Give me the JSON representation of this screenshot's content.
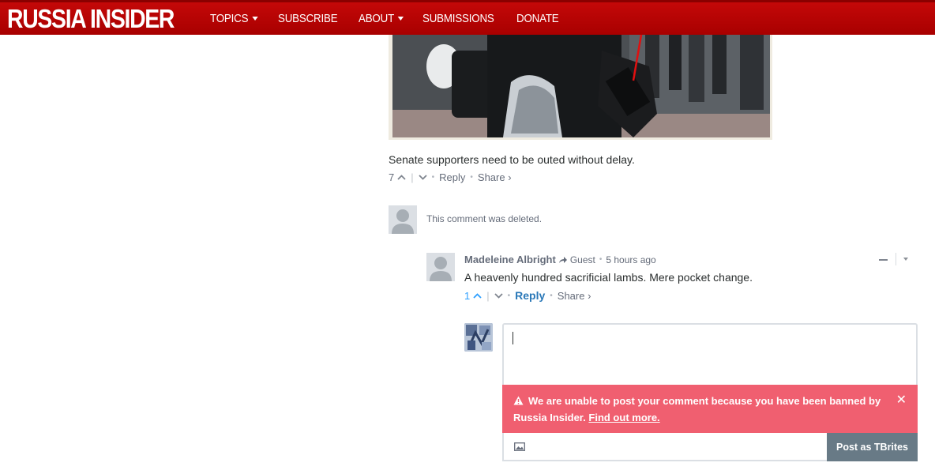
{
  "site": {
    "logo": "RUSSIA INSIDER",
    "nav": [
      {
        "label": "TOPICS",
        "dropdown": true
      },
      {
        "label": "SUBSCRIBE",
        "dropdown": false
      },
      {
        "label": "ABOUT",
        "dropdown": true
      },
      {
        "label": "SUBMISSIONS",
        "dropdown": false
      },
      {
        "label": "DONATE",
        "dropdown": false
      }
    ],
    "brand_color": "#b80000"
  },
  "comment1": {
    "text": "Senate supporters need to be outed without delay.",
    "votes": "7",
    "reply": "Reply",
    "share": "Share ›"
  },
  "deleted_comment": {
    "text": "This comment was deleted."
  },
  "comment2": {
    "author": "Madeleine Albright",
    "badge": "Guest",
    "time": "5 hours ago",
    "text": "A heavenly hundred sacrificial lambs. Mere pocket change.",
    "votes": "1",
    "reply": "Reply",
    "share": "Share ›"
  },
  "reply_box": {
    "value": "",
    "alert_text": "We are unable to post your comment because you have been banned by Russia Insider.",
    "alert_link": "Find out more.",
    "post_button": "Post as TBrites",
    "alert_color": "#f05f70"
  }
}
